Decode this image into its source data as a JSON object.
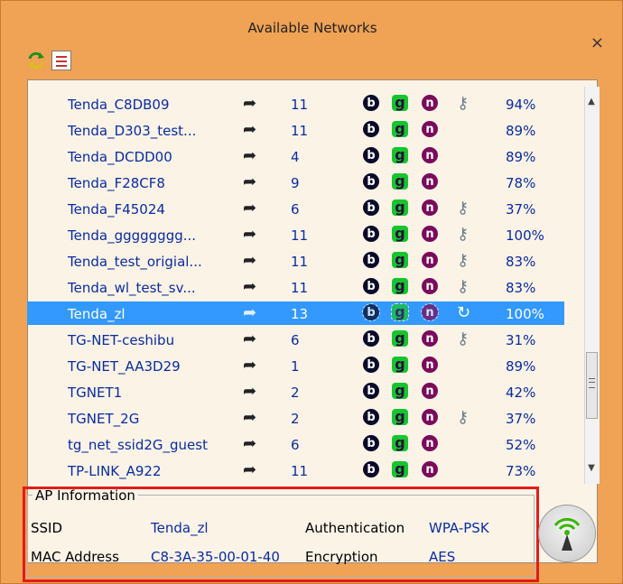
{
  "window": {
    "title": "Available Networks",
    "close_label": "×"
  },
  "toolbar": {
    "refresh_icon": "refresh-icon",
    "list_icon": "list-icon"
  },
  "networks": [
    {
      "ssid": "Tenda_C8DB09",
      "channel": "11",
      "b": "b",
      "g": "g",
      "n": "n",
      "secured": true,
      "signal": "94%"
    },
    {
      "ssid": "Tenda_D303_test...",
      "channel": "11",
      "b": "b",
      "g": "g",
      "n": "n",
      "secured": false,
      "signal": "89%"
    },
    {
      "ssid": "Tenda_DCDD00",
      "channel": "4",
      "b": "b",
      "g": "g",
      "n": "n",
      "secured": false,
      "signal": "89%"
    },
    {
      "ssid": "Tenda_F28CF8",
      "channel": "9",
      "b": "b",
      "g": "g",
      "n": "n",
      "secured": false,
      "signal": "78%"
    },
    {
      "ssid": "Tenda_F45024",
      "channel": "6",
      "b": "b",
      "g": "g",
      "n": "n",
      "secured": true,
      "signal": "37%"
    },
    {
      "ssid": "Tenda_gggggggg...",
      "channel": "11",
      "b": "b",
      "g": "g",
      "n": "n",
      "secured": true,
      "signal": "100%"
    },
    {
      "ssid": "Tenda_test_origial...",
      "channel": "11",
      "b": "b",
      "g": "g",
      "n": "n",
      "secured": true,
      "signal": "83%"
    },
    {
      "ssid": "Tenda_wl_test_sv...",
      "channel": "11",
      "b": "b",
      "g": "g",
      "n": "n",
      "secured": true,
      "signal": "83%"
    },
    {
      "ssid": "Tenda_zl",
      "channel": "13",
      "b": "b",
      "g": "g",
      "n": "n",
      "secured": true,
      "signal": "100%",
      "selected": true
    },
    {
      "ssid": "TG-NET-ceshibu",
      "channel": "6",
      "b": "b",
      "g": "g",
      "n": "n",
      "secured": true,
      "signal": "31%"
    },
    {
      "ssid": "TG-NET_AA3D29",
      "channel": "1",
      "b": "b",
      "g": "g",
      "n": "n",
      "secured": false,
      "signal": "89%"
    },
    {
      "ssid": "TGNET1",
      "channel": "2",
      "b": "b",
      "g": "g",
      "n": "n",
      "secured": false,
      "signal": "42%"
    },
    {
      "ssid": "TGNET_2G",
      "channel": "2",
      "b": "b",
      "g": "g",
      "n": "n",
      "secured": true,
      "signal": "37%"
    },
    {
      "ssid": "tg_net_ssid2G_guest",
      "channel": "6",
      "b": "b",
      "g": "g",
      "n": "n",
      "secured": false,
      "signal": "52%"
    },
    {
      "ssid": "TP-LINK_A922",
      "channel": "11",
      "b": "b",
      "g": "g",
      "n": "n",
      "secured": false,
      "signal": "73%"
    }
  ],
  "ap_info": {
    "legend": "AP Information",
    "ssid_label": "SSID",
    "ssid_value": "Tenda_zl",
    "mac_label": "MAC Address",
    "mac_value": "C8-3A-35-00-01-40",
    "auth_label": "Authentication",
    "auth_value": "WPA-PSK",
    "enc_label": "Encryption",
    "enc_value": "AES"
  },
  "colors": {
    "window_bg": "#f0a255",
    "list_bg": "#fbf3e6",
    "selection": "#3399ff",
    "text_blue": "#0a2c9e",
    "highlight_border": "#e31b1b"
  }
}
